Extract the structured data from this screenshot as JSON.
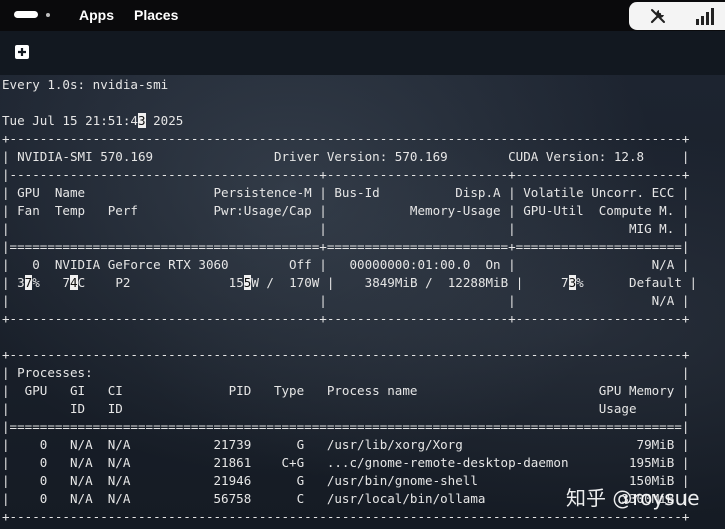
{
  "topbar": {
    "apps_label": "Apps",
    "places_label": "Places"
  },
  "terminal": {
    "lines": [
      "Every 1.0s: nvidia-smi",
      "",
      [
        "Tue Jul 15 21:51:4",
        "3",
        " 2025"
      ],
      "+-----------------------------------------------------------------------------------------+",
      "| NVIDIA-SMI 570.169                Driver Version: 570.169        CUDA Version: 12.8     |",
      "|-----------------------------------------+------------------------+----------------------+",
      "| GPU  Name                 Persistence-M | Bus-Id          Disp.A | Volatile Uncorr. ECC |",
      "| Fan  Temp   Perf          Pwr:Usage/Cap |           Memory-Usage | GPU-Util  Compute M. |",
      "|                                         |                        |               MIG M. |",
      "|=========================================+========================+======================|",
      "|   0  NVIDIA GeForce RTX 3060        Off |   00000000:01:00.0  On |                  N/A |",
      [
        "| 3",
        "7",
        "%   7",
        "4",
        "C    P2             15",
        "5",
        "W /  170W |    3849MiB /  12288MiB |     7",
        "3",
        "%      Default |"
      ],
      "|                                         |                        |                  N/A |",
      "+-----------------------------------------+------------------------+----------------------+",
      "",
      "+-----------------------------------------------------------------------------------------+",
      "| Processes:                                                                              |",
      "|  GPU   GI   CI              PID   Type   Process name                        GPU Memory |",
      "|        ID   ID                                                               Usage      |",
      "|=========================================================================================|",
      "|    0   N/A  N/A           21739      G   /usr/lib/xorg/Xorg                       79MiB |",
      "|    0   N/A  N/A           21861    C+G   ...c/gnome-remote-desktop-daemon        195MiB |",
      "|    0   N/A  N/A           21946      G   /usr/bin/gnome-shell                    150MiB |",
      "|    0   N/A  N/A           56758      C   /usr/local/bin/ollama                  3300MiB |",
      "+-----------------------------------------------------------------------------------------+"
    ]
  },
  "watermark": "知乎 @roysue",
  "colors": {
    "topbar_bg": "#0a0a0c",
    "terminal_bg": "#1b222c",
    "terminal_fg": "#e6e6e6",
    "tray_bg": "#f4f4f4"
  },
  "icons": {
    "activities": "activities-pill-icon",
    "new_tab": "new-tab-icon",
    "tray_tools": "wrench-icon",
    "tray_network": "signal-icon"
  }
}
